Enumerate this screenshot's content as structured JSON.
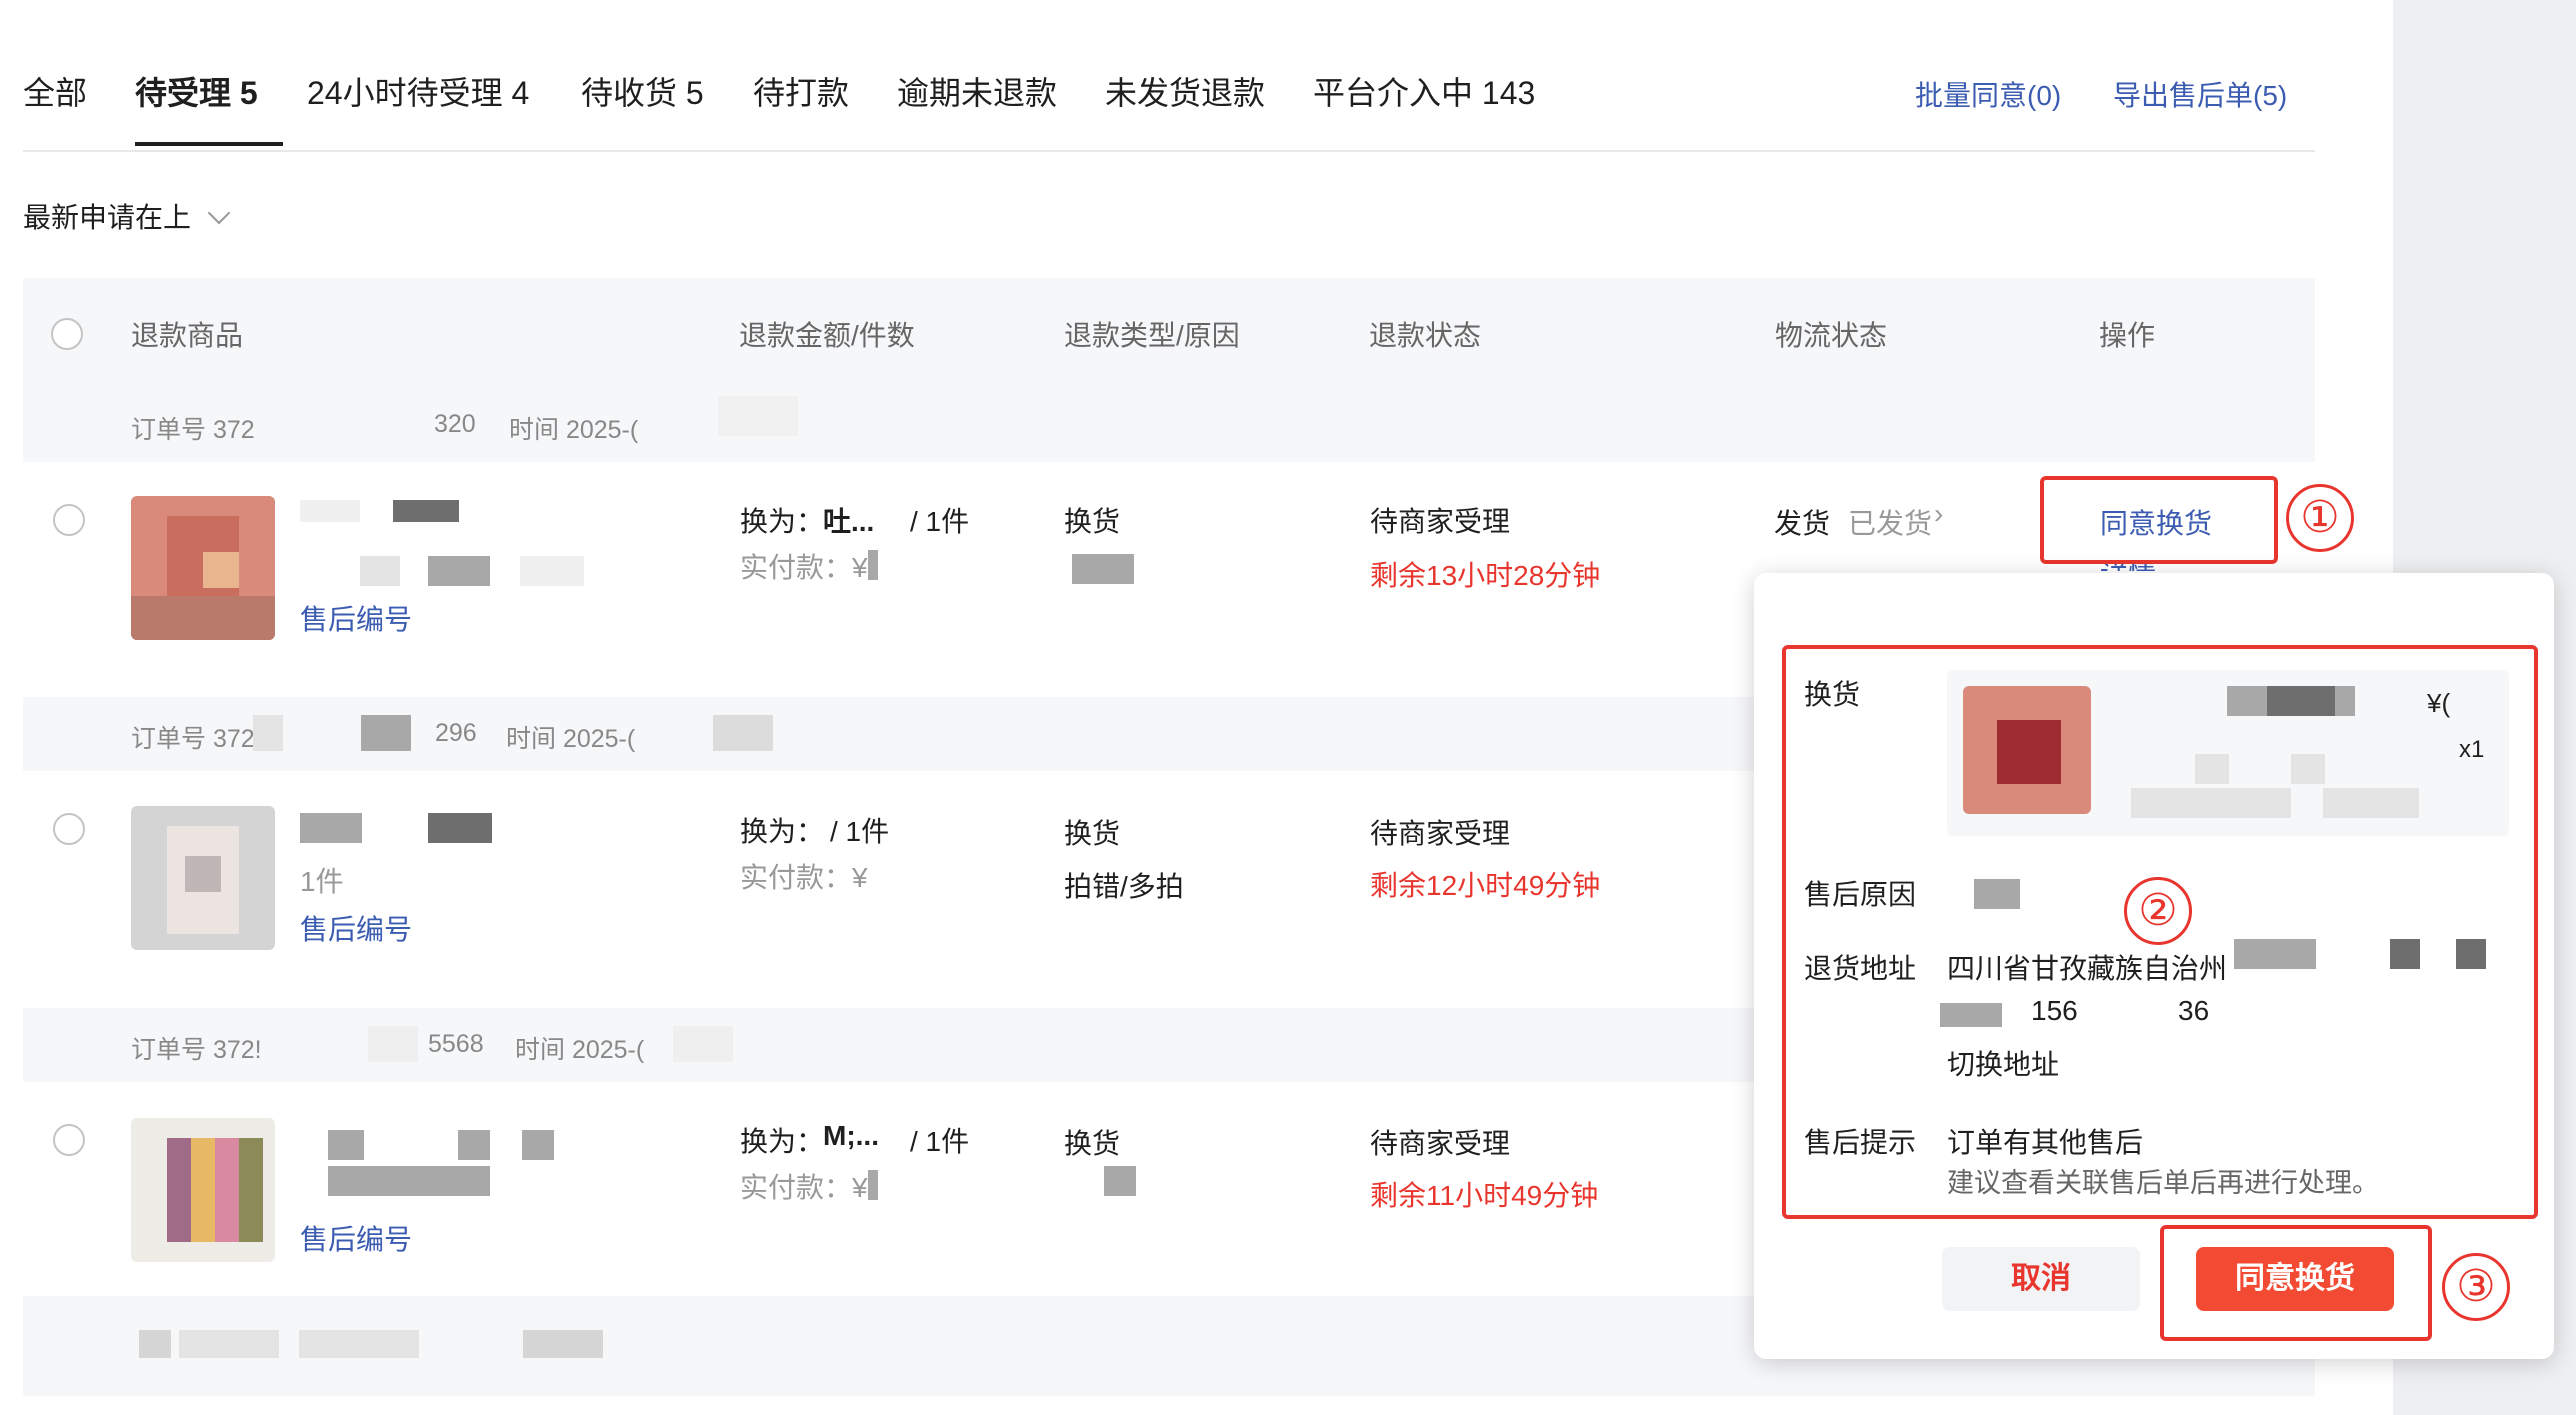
{
  "tabs": [
    {
      "label": "全部"
    },
    {
      "label": "待受理 5"
    },
    {
      "label": "24小时待受理 4"
    },
    {
      "label": "待收货 5"
    },
    {
      "label": "待打款"
    },
    {
      "label": "逾期未退款"
    },
    {
      "label": "未发货退款"
    },
    {
      "label": "平台介入中 143"
    }
  ],
  "actions": {
    "batch_agree": "批量同意(0)",
    "export": "导出售后单(5)"
  },
  "sort": {
    "label": "最新申请在上"
  },
  "columns": [
    "退款商品",
    "退款金额/件数",
    "退款类型/原因",
    "退款状态",
    "物流状态",
    "操作"
  ],
  "orders": [
    {
      "order_prefix": "订单号 372",
      "order_suffix": "320",
      "time_label": "时间 2025-(",
      "exchange_for": "换为：",
      "exchange_item": "吐...",
      "qty": "/ 1件",
      "paid_label": "实付款：¥",
      "type": "换货",
      "status": "待商家受理",
      "remaining": "剩余13小时28分钟",
      "logistics": "发货",
      "shipped": "已发货",
      "aftersale_no": "售后编号",
      "action": "同意换货",
      "action2": "详情"
    },
    {
      "order_prefix": "订单号 372",
      "order_suffix": "296",
      "time_label": "时间 2025-(",
      "exchange_for": "换为：",
      "qty": "/ 1件",
      "paid_label": "实付款：¥",
      "type": "换货",
      "reason": "拍错/多拍",
      "status": "待商家受理",
      "remaining": "剩余12小时49分钟",
      "item_count": "1件",
      "aftersale_no": "售后编号"
    },
    {
      "order_prefix": "订单号 372!",
      "order_suffix": "5568",
      "time_label": "时间 2025-(",
      "exchange_for": "换为：",
      "exchange_item": "M;...",
      "qty": "/ 1件",
      "paid_label": "实付款：¥",
      "type": "换货",
      "status": "待商家受理",
      "remaining": "剩余11小时49分钟",
      "aftersale_no": "售后编号"
    }
  ],
  "popup": {
    "exchange_label": "换货",
    "price_prefix": "¥(",
    "qty": "x1",
    "reason_label": "售后原因",
    "address_label": "退货地址",
    "address_text": "四川省甘孜藏族自治州",
    "phone_prefix": "156",
    "phone_suffix": "36",
    "switch_address": "切换地址",
    "tip_label": "售后提示",
    "tip_warning": "订单有其他售后",
    "tip_text": "建议查看关联售后单后再进行处理。",
    "cancel": "取消",
    "agree": "同意换货"
  },
  "annotations": [
    "①",
    "②",
    "③"
  ],
  "colors": {
    "accent_red": "#e8362e",
    "link_blue": "#3b5cb0",
    "warning_orange": "#f08a1c",
    "button_red": "#f24a33"
  }
}
